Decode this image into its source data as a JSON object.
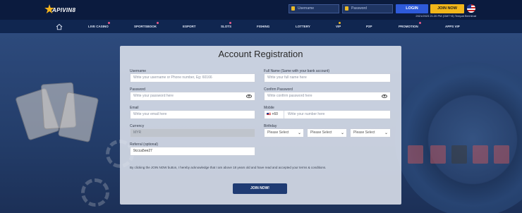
{
  "header": {
    "logo_text": "APIVIN8",
    "username_placeholder": "Username",
    "password_placeholder": "Password",
    "login_label": "LOGIN",
    "join_label": "JOIN NOW",
    "info_line": "2021/2023 21:20 PM (GMT+8) Tempat Berminat"
  },
  "nav": {
    "items": [
      {
        "label": "LIVE CASINO",
        "dot": true
      },
      {
        "label": "SPORTSBOOK",
        "dot": true
      },
      {
        "label": "ESPORT",
        "dot": false
      },
      {
        "label": "SLOTS",
        "dot": true
      },
      {
        "label": "FISHING",
        "dot": false
      },
      {
        "label": "LOTTERY",
        "dot": false
      },
      {
        "label": "VIP",
        "dot": true
      },
      {
        "label": "P2P",
        "dot": false
      },
      {
        "label": "PROMOTION",
        "dot": true
      },
      {
        "label": "APPS VIP",
        "dot": false
      }
    ]
  },
  "form": {
    "title": "Account Registration",
    "username_label": "Username",
    "username_placeholder": "Write your username or Phone number, Eg: 60166",
    "fullname_label": "Full Name (Same with your bank account)",
    "fullname_placeholder": "Write your full name here",
    "password_label": "Password",
    "password_placeholder": "Write your password here",
    "confirm_label": "Confirm Password",
    "confirm_placeholder": "Write confirm password here",
    "email_label": "Email",
    "email_placeholder": "Write your email here",
    "mobile_label": "Mobile",
    "phone_prefix": "+60",
    "mobile_placeholder": "Write your number here",
    "currency_label": "Currency",
    "currency_value": "MYR",
    "birthday_label": "Birthday",
    "year_select": "Please Select",
    "month_select": "Please Select",
    "day_select": "Please Select",
    "referral_label": "Referral (optional)",
    "referral_value": "9ccca5ee27",
    "agreement_text": "By clicking the JOIN NOW button, I hereby acknowledge that I am above 18 years old and have read and accepted your terms & conditions.",
    "submit_label": "JOIN NOW!"
  }
}
